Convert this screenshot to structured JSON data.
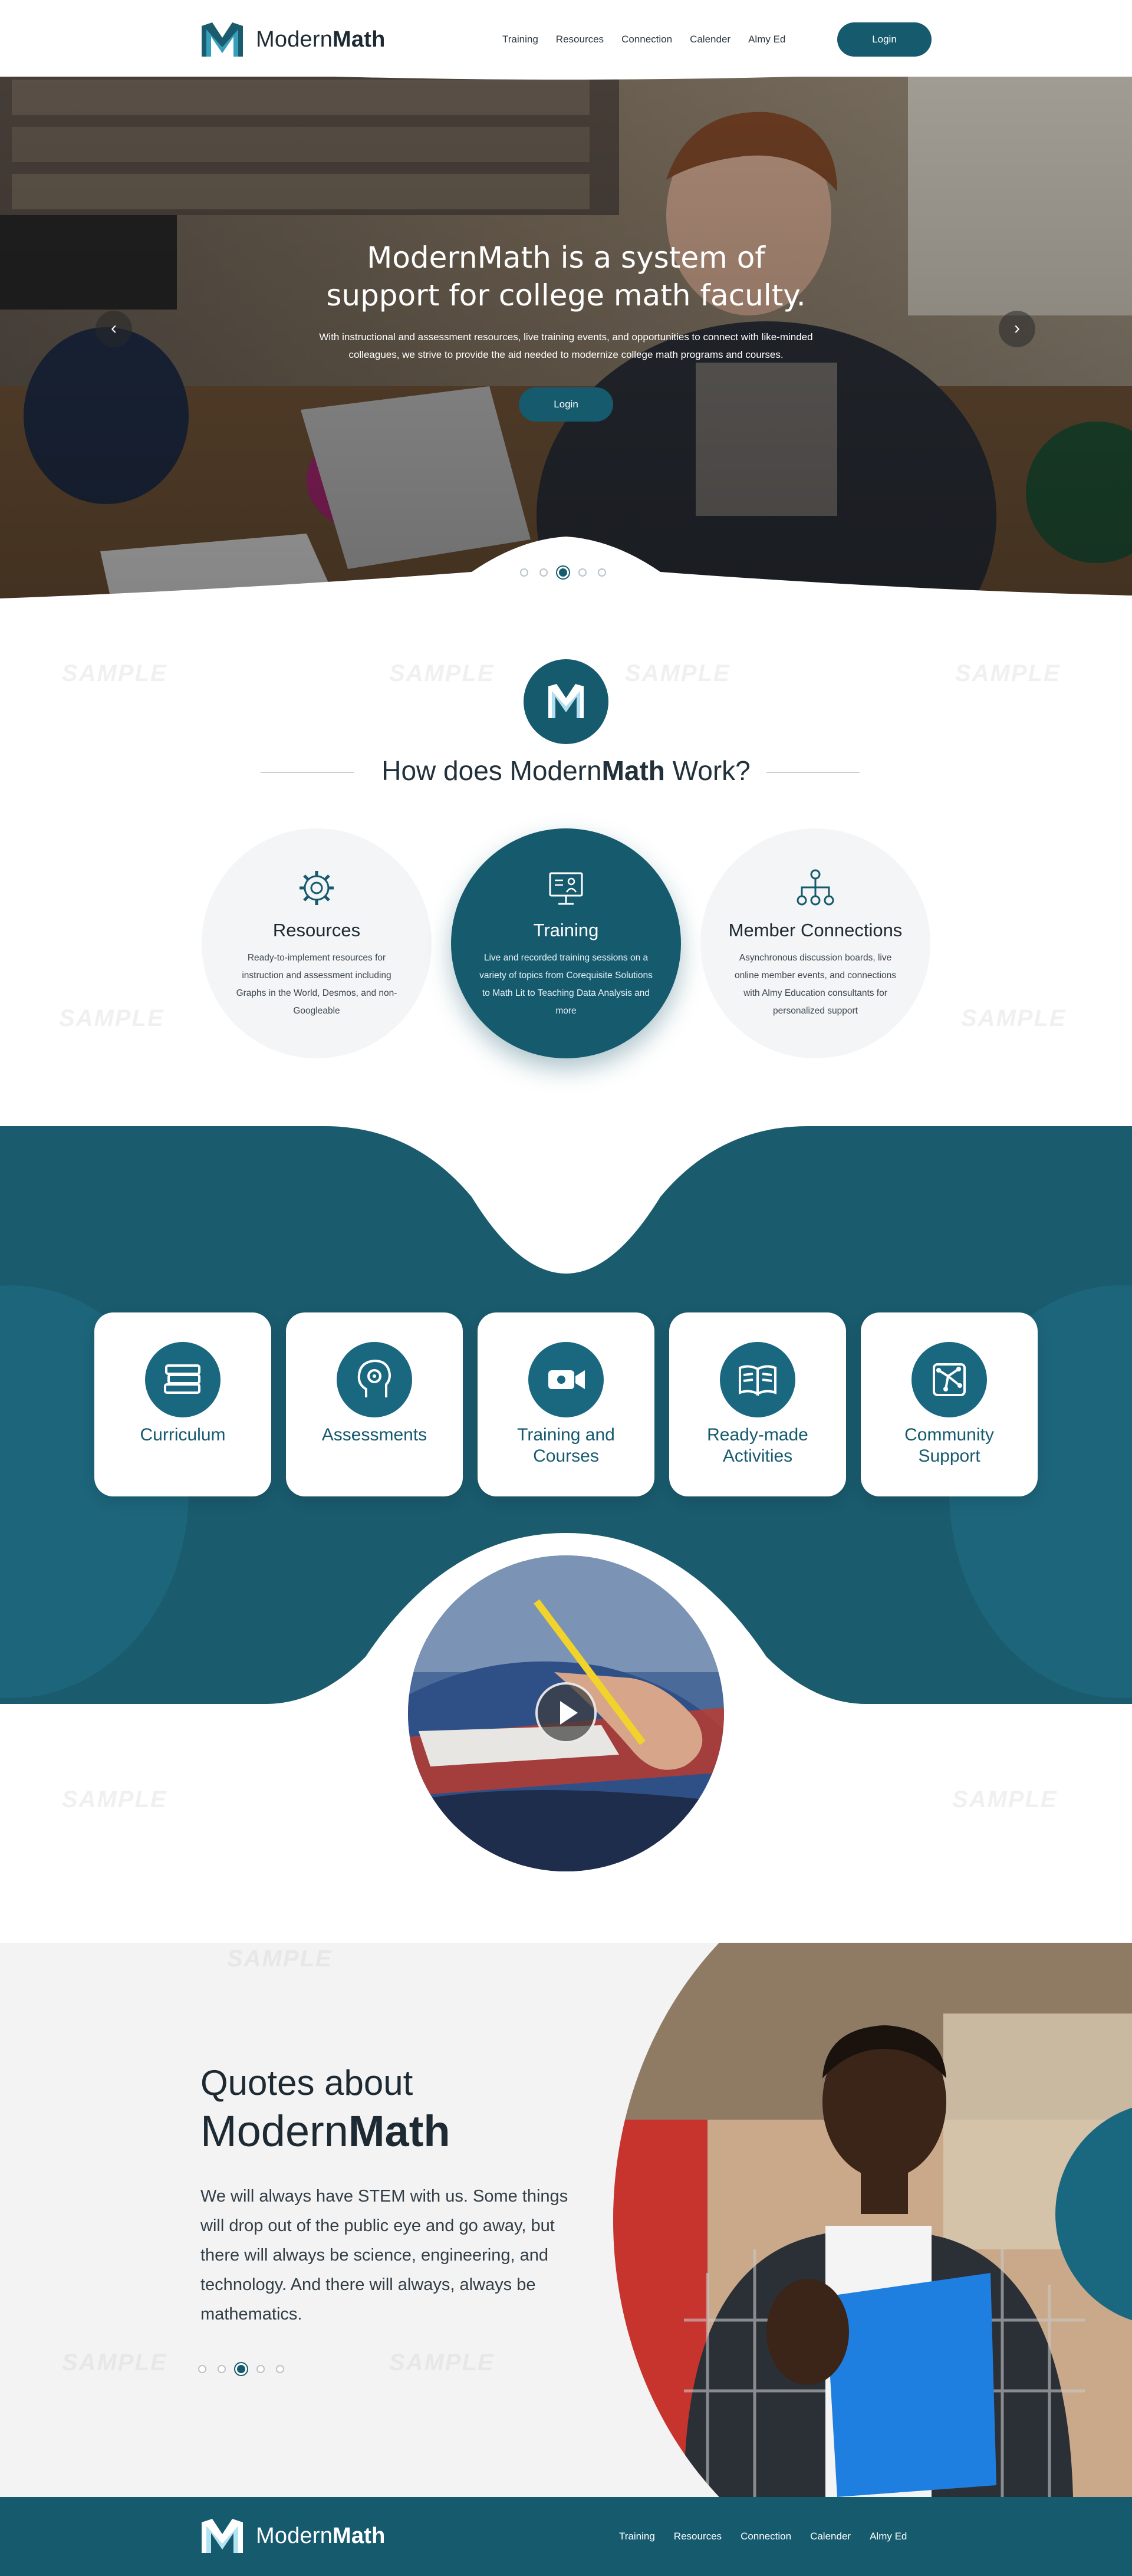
{
  "brand": {
    "name_regular": "Modern",
    "name_bold": "Math",
    "teal": "#165a6e",
    "teal_dark": "#1a5b6e"
  },
  "header": {
    "nav": [
      "Training",
      "Resources",
      "Connection",
      "Calender",
      "Almy Ed"
    ],
    "login_label": "Login"
  },
  "hero": {
    "title_line1": "ModernMath is a system of",
    "title_line2": "support for college math faculty.",
    "subtitle_line1": "With instructional and assessment resources, live training events, and opportunities to connect with like-minded",
    "subtitle_line2": "colleagues, we strive to provide the aid needed to modernize college math programs and courses.",
    "button_label": "Login",
    "prev_icon": "chevron-left-icon",
    "next_icon": "chevron-right-icon",
    "slides_total": 5,
    "slide_active": 3
  },
  "how": {
    "title_regular": "How does Modern",
    "title_bold": "Math",
    "title_suffix": " Work?",
    "cards": [
      {
        "title": "Resources",
        "body": "Ready-to-implement resources for instruction and assessment including Graphs in the World, Desmos, and non-Googleable",
        "icon": "gear-icon",
        "active": false
      },
      {
        "title": "Training",
        "body": "Live and recorded training sessions on a variety of topics from Corequisite Solutions to Math Lit to Teaching Data Analysis and more",
        "icon": "presentation-icon",
        "active": true
      },
      {
        "title": "Member Connections",
        "body": "Asynchronous discussion boards, live online member events, and connections with Almy Education consultants for personalized support",
        "icon": "network-icon",
        "active": false
      }
    ]
  },
  "features": [
    {
      "label_line1": "Curriculum",
      "label_line2": "",
      "icon": "books-icon"
    },
    {
      "label_line1": "Assessments",
      "label_line2": "",
      "icon": "head-gear-icon"
    },
    {
      "label_line1": "Training and",
      "label_line2": "Courses",
      "icon": "video-camera-icon"
    },
    {
      "label_line1": "Ready-made",
      "label_line2": "Activities",
      "icon": "open-book-icon"
    },
    {
      "label_line1": "Community",
      "label_line2": "Support",
      "icon": "community-map-icon"
    }
  ],
  "video": {
    "icon": "play-icon"
  },
  "quotes": {
    "heading_line1": "Quotes about",
    "heading_regular": "Modern",
    "heading_bold": "Math",
    "body": "We will always have STEM with us. Some things will drop out of the public eye and go away, but there will always be science, engineering, and technology. And there will always, always be mathematics.",
    "slides_total": 5,
    "slide_active": 3
  },
  "footer": {
    "nav": [
      "Training",
      "Resources",
      "Connection",
      "Calender",
      "Almy Ed"
    ]
  },
  "watermark_text": "SAMPLE"
}
